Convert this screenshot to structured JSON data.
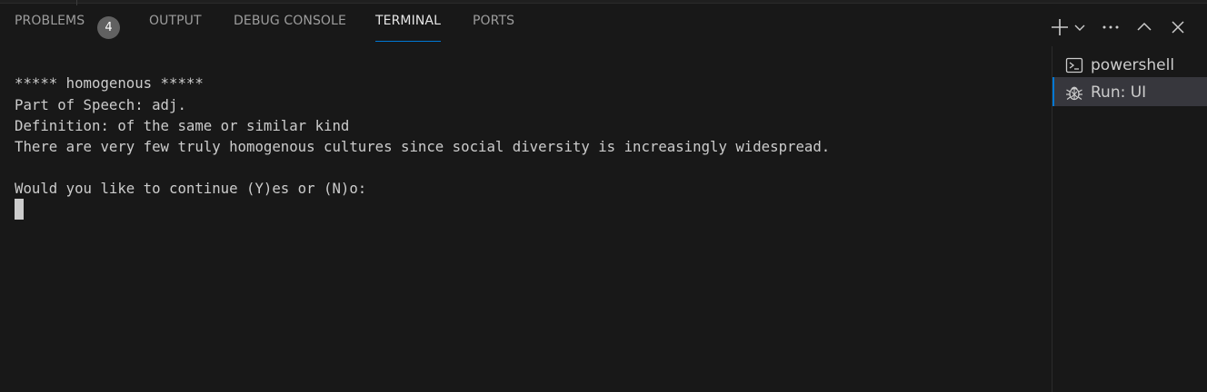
{
  "panel": {
    "tabs": [
      {
        "label": "PROBLEMS",
        "badge": "4"
      },
      {
        "label": "OUTPUT"
      },
      {
        "label": "DEBUG CONSOLE"
      },
      {
        "label": "TERMINAL",
        "active": true
      },
      {
        "label": "PORTS"
      }
    ],
    "actions": [
      "plus-icon",
      "chevron-down-icon",
      "ellipsis-icon",
      "chevron-up-icon",
      "close-icon"
    ]
  },
  "terminal": {
    "lines": [
      "***** homogenous *****",
      "Part of Speech: adj.",
      "Definition: of the same or similar kind",
      "There are very few truly homogenous cultures since social diversity is increasingly widespread.",
      "",
      "Would you like to continue (Y)es or (N)o:"
    ]
  },
  "terminal_list": [
    {
      "label": "powershell",
      "icon": "powershell-icon"
    },
    {
      "label": "Run: UI",
      "icon": "debug-icon",
      "selected": true
    }
  ],
  "colors": {
    "background": "#181818",
    "accent": "#0078d4",
    "text": "#cccccc",
    "badge": "#616161",
    "selected_item": "#37373d"
  }
}
